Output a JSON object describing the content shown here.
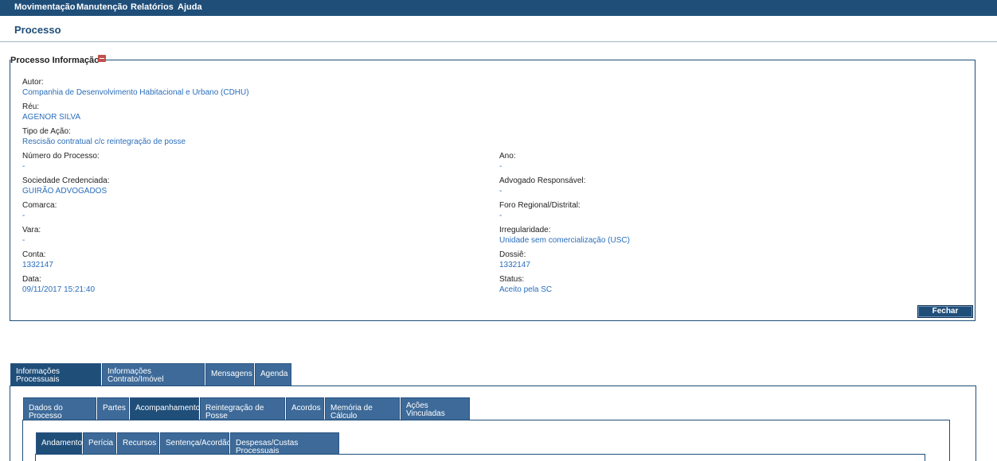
{
  "topnav": {
    "items": [
      "Movimentação",
      "Manutenção",
      "Relatórios",
      "Ajuda"
    ]
  },
  "page": {
    "title": "Processo"
  },
  "info": {
    "legend": "Processo Informação",
    "fields": {
      "autor": {
        "label": "Autor:",
        "value": "Companhia de Desenvolvimento Habitacional e Urbano (CDHU)"
      },
      "reu": {
        "label": "Réu:",
        "value": "AGENOR SILVA"
      },
      "tipo_acao": {
        "label": "Tipo de Ação:",
        "value": "Rescisão contratual c/c reintegração de posse"
      },
      "numero_processo": {
        "label": "Número do Processo:",
        "value": "-"
      },
      "ano": {
        "label": "Ano:",
        "value": "-"
      },
      "sociedade": {
        "label": "Sociedade Credenciada:",
        "value": "GUIRÃO ADVOGADOS"
      },
      "advogado": {
        "label": "Advogado Responsável:",
        "value": "-"
      },
      "comarca": {
        "label": "Comarca:",
        "value": "-"
      },
      "foro": {
        "label": "Foro Regional/Distrital:",
        "value": "-"
      },
      "vara": {
        "label": "Vara:",
        "value": "-"
      },
      "irregularidade": {
        "label": "Irregularidade:",
        "value": "Unidade sem comercialização (USC)"
      },
      "conta": {
        "label": "Conta:",
        "value": "1332147"
      },
      "dossie": {
        "label": "Dossiê:",
        "value": "1332147"
      },
      "data": {
        "label": "Data:",
        "value": "09/11/2017 15:21:40"
      },
      "status": {
        "label": "Status:",
        "value": "Aceito pela SC"
      }
    },
    "close_button": "Fechar"
  },
  "tabs_level1": [
    {
      "line1": "Informações",
      "line2": "Processuais",
      "active": true
    },
    {
      "line1": "Informações",
      "line2": "Contrato/Imóvel",
      "active": false
    },
    {
      "line1": "Mensagens",
      "line2": "",
      "active": false
    },
    {
      "line1": "Agenda",
      "line2": "",
      "active": false
    }
  ],
  "tabs_level2": [
    {
      "line1": "Dados do Processo",
      "line2": "",
      "active": false
    },
    {
      "line1": "Partes",
      "line2": "",
      "active": false
    },
    {
      "line1": "Acompanhamento",
      "line2": "",
      "active": true
    },
    {
      "line1": "Reintegração de Posse",
      "line2": "",
      "active": false
    },
    {
      "line1": "Acordos",
      "line2": "",
      "active": false
    },
    {
      "line1": "Memória de Cálculo",
      "line2": "",
      "active": false
    },
    {
      "line1": "Ações",
      "line2": "Vinculadas",
      "active": false
    }
  ],
  "tabs_level3": [
    {
      "line1": "Andamento",
      "active": true
    },
    {
      "line1": "Perícia",
      "active": false
    },
    {
      "line1": "Recursos",
      "active": false
    },
    {
      "line1": "Sentença/Acordão",
      "active": false
    },
    {
      "line1": "Despesas/Custas Processuais",
      "active": false
    }
  ]
}
